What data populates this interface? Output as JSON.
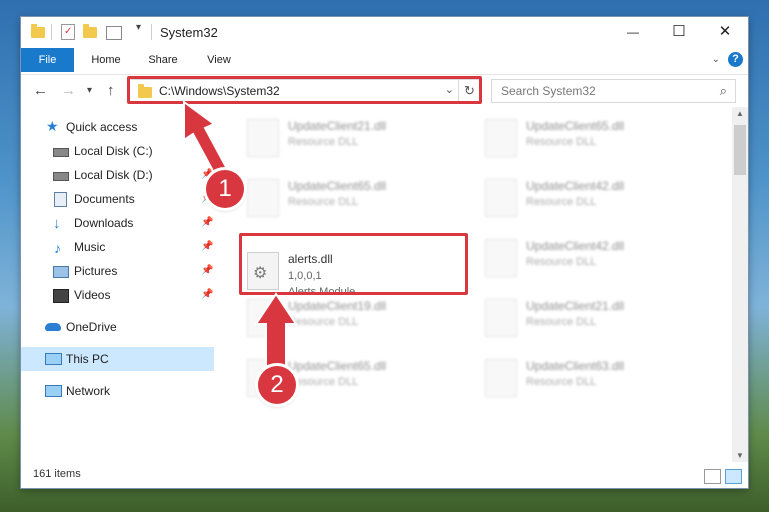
{
  "window": {
    "title": "System32"
  },
  "controls": {
    "minimize": "—",
    "maximize": "☐",
    "close": "✕"
  },
  "ribbon": {
    "tabs": [
      "File",
      "Home",
      "Share",
      "View"
    ],
    "help": "?"
  },
  "nav": {
    "address": "C:\\Windows\\System32",
    "search_placeholder": "Search System32"
  },
  "sidebar": {
    "items": [
      {
        "label": "Quick access",
        "icon": "star-icon"
      },
      {
        "label": "Local Disk (C:)",
        "icon": "drive-icon"
      },
      {
        "label": "Local Disk (D:)",
        "icon": "drive-icon"
      },
      {
        "label": "Documents",
        "icon": "documents-icon"
      },
      {
        "label": "Downloads",
        "icon": "download-icon"
      },
      {
        "label": "Music",
        "icon": "music-icon"
      },
      {
        "label": "Pictures",
        "icon": "pictures-icon"
      },
      {
        "label": "Videos",
        "icon": "videos-icon"
      },
      {
        "label": "OneDrive",
        "icon": "cloud-icon"
      },
      {
        "label": "This PC",
        "icon": "computer-icon"
      },
      {
        "label": "Network",
        "icon": "network-icon"
      }
    ]
  },
  "files": {
    "left": [
      {
        "name": "UpdateClient21.dll",
        "desc": "Resource DLL"
      },
      {
        "name": "UpdateClient65.dll",
        "desc": "Resource DLL"
      },
      {
        "name": "UpdateClient19.dll",
        "desc": "Resource DLL"
      },
      {
        "name": "UpdateClient65.dll",
        "desc": "Resource DLL"
      }
    ],
    "right": [
      {
        "name": "UpdateClient65.dll",
        "desc": "Resource DLL"
      },
      {
        "name": "UpdateClient42.dll",
        "desc": "Resource DLL"
      },
      {
        "name": "UpdateClient42.dll",
        "desc": "Resource DLL"
      },
      {
        "name": "UpdateClient21.dll",
        "desc": "Resource DLL"
      },
      {
        "name": "UpdateClient63.dll",
        "desc": "Resource DLL"
      }
    ],
    "highlight": {
      "name": "alerts.dll",
      "version": "1,0,0,1",
      "desc": "Alerts Module"
    }
  },
  "status": {
    "count": "161 items"
  },
  "annotations": {
    "one": "1",
    "two": "2",
    "color": "#d9373f"
  }
}
